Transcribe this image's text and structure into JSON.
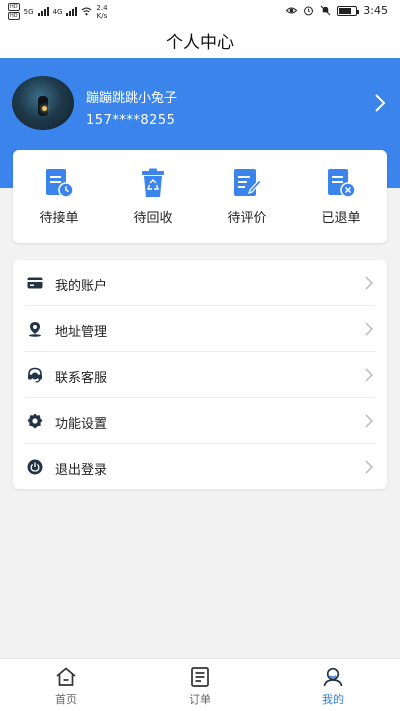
{
  "status_bar": {
    "hd_badges": [
      "HD",
      "HD"
    ],
    "network": "5G",
    "network2": "4G",
    "speed_value": "2.4",
    "speed_unit": "K/s",
    "time": "3:45"
  },
  "header": {
    "title": "个人中心"
  },
  "profile": {
    "nickname": "蹦蹦跳跳小兔子",
    "phone": "157****8255"
  },
  "order_shortcuts": [
    {
      "label": "待接单",
      "icon": "clock-document-icon"
    },
    {
      "label": "待回收",
      "icon": "recycle-bin-icon"
    },
    {
      "label": "待评价",
      "icon": "edit-document-icon"
    },
    {
      "label": "已退单",
      "icon": "cancel-document-icon"
    }
  ],
  "menu": [
    {
      "label": "我的账户",
      "icon": "card-icon"
    },
    {
      "label": "地址管理",
      "icon": "location-pin-icon"
    },
    {
      "label": "联系客服",
      "icon": "headset-icon"
    },
    {
      "label": "功能设置",
      "icon": "gear-icon"
    },
    {
      "label": "退出登录",
      "icon": "power-icon"
    }
  ],
  "tabbar": [
    {
      "label": "首页",
      "icon": "home-icon",
      "active": false
    },
    {
      "label": "订单",
      "icon": "order-list-icon",
      "active": false
    },
    {
      "label": "我的",
      "icon": "user-icon",
      "active": true
    }
  ],
  "colors": {
    "brand": "#3a84ec",
    "active_tab": "#2f7cec",
    "background": "#f2f2f2"
  }
}
